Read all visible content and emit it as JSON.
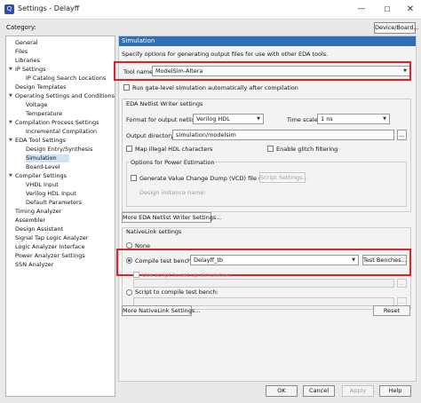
{
  "window": {
    "title": "Settings - Delayff"
  },
  "category_label": "Category:",
  "device_board_label": "Device/Board...",
  "tree": {
    "items": [
      {
        "label": "General"
      },
      {
        "label": "Files"
      },
      {
        "label": "Libraries"
      },
      {
        "label": "IP Settings"
      },
      {
        "label": "IP Catalog Search Locations"
      },
      {
        "label": "Design Templates"
      },
      {
        "label": "Operating Settings and Conditions"
      },
      {
        "label": "Voltage"
      },
      {
        "label": "Temperature"
      },
      {
        "label": "Compilation Process Settings"
      },
      {
        "label": "Incremental Compilation"
      },
      {
        "label": "EDA Tool Settings"
      },
      {
        "label": "Design Entry/Synthesis"
      },
      {
        "label": "Simulation"
      },
      {
        "label": "Board-Level"
      },
      {
        "label": "Compiler Settings"
      },
      {
        "label": "VHDL Input"
      },
      {
        "label": "Verilog HDL Input"
      },
      {
        "label": "Default Parameters"
      },
      {
        "label": "Timing Analyzer"
      },
      {
        "label": "Assembler"
      },
      {
        "label": "Design Assistant"
      },
      {
        "label": "Signal Tap Logic Analyzer"
      },
      {
        "label": "Logic Analyzer Interface"
      },
      {
        "label": "Power Analyzer Settings"
      },
      {
        "label": "SSN Analyzer"
      }
    ],
    "selected": "Simulation"
  },
  "panel": {
    "header": "Simulation",
    "description": "Specify options for generating output files for use with other EDA tools.",
    "tool_name_label": "Tool name:",
    "tool_name_value": "ModelSim-Altera",
    "run_gate_level": {
      "label": "Run gate-level simulation automatically after compilation",
      "checked": false
    },
    "eda_netlist": {
      "title": "EDA Netlist Writer settings",
      "format_label": "Format for output netlist:",
      "format_value": "Verilog HDL",
      "timescale_label": "Time scale:",
      "timescale_value": "1 ns",
      "output_dir_label": "Output directory:",
      "output_dir_value": "simulation/modelsim",
      "browse_label": "...",
      "map_illegal_label": "Map illegal HDL characters",
      "glitch_label": "Enable glitch filtering",
      "power": {
        "title": "Options for Power Estimation",
        "vcd_label": "Generate Value Change Dump (VCD) file script",
        "script_settings_label": "Script Settings...",
        "design_instance_label": "Design instance name:"
      }
    },
    "more_eda_button": "More EDA Netlist Writer Settings...",
    "nativelink": {
      "title": "NativeLink settings",
      "none_label": "None",
      "compile_tb_label": "Compile test bench:",
      "compile_tb_value": "Delayff_tb",
      "test_benches_button": "Test Benches...",
      "use_script_label": "Use script to set up simulation:",
      "script_compile_label": "Script to compile test bench:",
      "selected": "compile_test_bench"
    },
    "more_nativelink_button": "More NativeLink Settings...",
    "reset_button": "Reset"
  },
  "footer": {
    "ok": "OK",
    "cancel": "Cancel",
    "apply": "Apply",
    "help": "Help"
  },
  "colors": {
    "header_blue": "#2f6fb7",
    "highlight_red": "#e0202a",
    "selection": "#cfe3f8"
  }
}
